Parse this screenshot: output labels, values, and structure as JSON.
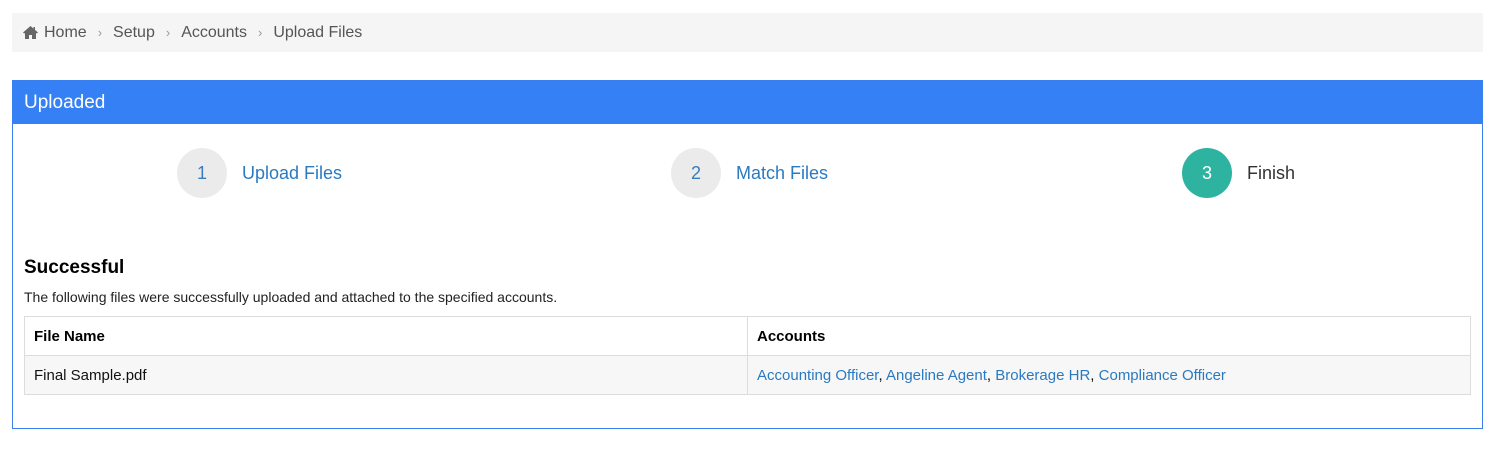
{
  "breadcrumb": {
    "icon": "home-icon",
    "items": [
      "Home",
      "Setup",
      "Accounts",
      "Upload Files"
    ],
    "separator": "›"
  },
  "panel": {
    "title": "Uploaded"
  },
  "steps": [
    {
      "number": "1",
      "label": "Upload Files",
      "state": "link"
    },
    {
      "number": "2",
      "label": "Match Files",
      "state": "link"
    },
    {
      "number": "3",
      "label": "Finish",
      "state": "active"
    }
  ],
  "result": {
    "title": "Successful",
    "description": "The following files were successfully uploaded and attached to the specified accounts.",
    "columns": [
      "File Name",
      "Accounts"
    ],
    "rows": [
      {
        "file_name": "Final Sample.pdf",
        "accounts": [
          "Accounting Officer",
          "Angeline Agent",
          "Brokerage HR",
          "Compliance Officer"
        ],
        "separator": ","
      }
    ]
  },
  "colors": {
    "header_bg": "#3580f4",
    "link": "#2a7ac1",
    "active_step": "#2fb3a1"
  }
}
